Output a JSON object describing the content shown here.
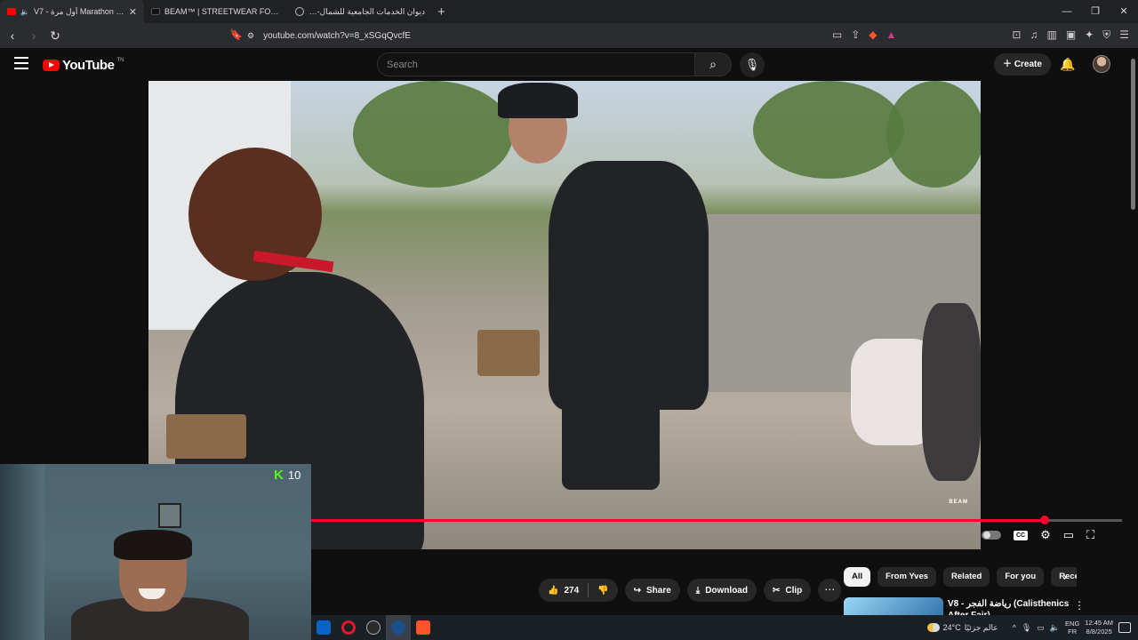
{
  "browser": {
    "tabs": [
      {
        "title": "V7 - أول مرة Marathon جريتا (",
        "active": true
      },
      {
        "title": "BEAM™ | STREETWEAR FOR HUSTLE",
        "active": false
      },
      {
        "title": "ديوان الخدمات الجامعية للشمال- الخدم",
        "active": false
      }
    ],
    "new_tab": "+",
    "url": "youtube.com/watch?v=8_xSGqQvcfE",
    "window_controls": {
      "minimize": "—",
      "restore": "❐",
      "close": "✕"
    }
  },
  "youtube": {
    "logo_text": "YouTube",
    "logo_region": "TN",
    "search_placeholder": "Search",
    "create_label": "Create"
  },
  "video": {
    "watermark": "BEAM",
    "progress_fraction": 0.905
  },
  "stream_overlay": {
    "kick_viewers": "10"
  },
  "actions": {
    "likes": "274",
    "share": "Share",
    "download": "Download",
    "clip": "Clip",
    "more": "⋯"
  },
  "chips": [
    "All",
    "From Yves",
    "Related",
    "For you",
    "Rece"
  ],
  "recommendation": {
    "title": "V8 - رياضة الفجر (Calisthenics After Fajr)"
  },
  "taskbar": {
    "temperature": "24°C",
    "weather_text": "عالم جزئيًا",
    "lang_top": "ENG",
    "lang_bottom": "FR",
    "time": "12:45 AM",
    "date": "8/8/2025"
  },
  "colors": {
    "youtube_red": "#ff0000",
    "progress_red": "#ff0033",
    "kick_green": "#53fc18",
    "background": "#0f0f0f"
  }
}
